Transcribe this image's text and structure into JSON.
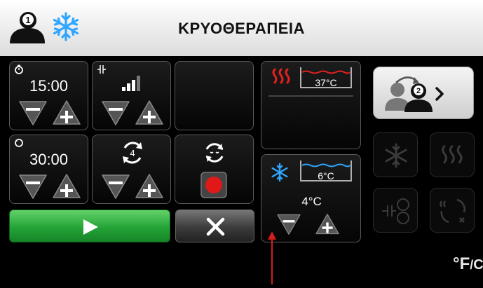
{
  "header": {
    "title": "ΚΡΥΟΘΕΡΑΠΕΙΑ",
    "user_number": "1"
  },
  "tiles": {
    "therapy_time": "15:00",
    "pause_time": "30:00",
    "cycles": "4"
  },
  "hot_bath": {
    "temperature": "37°C"
  },
  "cold_bath": {
    "temperature": "6°C",
    "setpoint": "4°C"
  },
  "side": {
    "switch_user_number": "2"
  },
  "units_toggle": {
    "f": "°F",
    "sep": "/",
    "c": "C"
  },
  "colors": {
    "accent_blue": "#2fa6ff",
    "heat_red": "#e32020",
    "start_green": "#24a336"
  }
}
